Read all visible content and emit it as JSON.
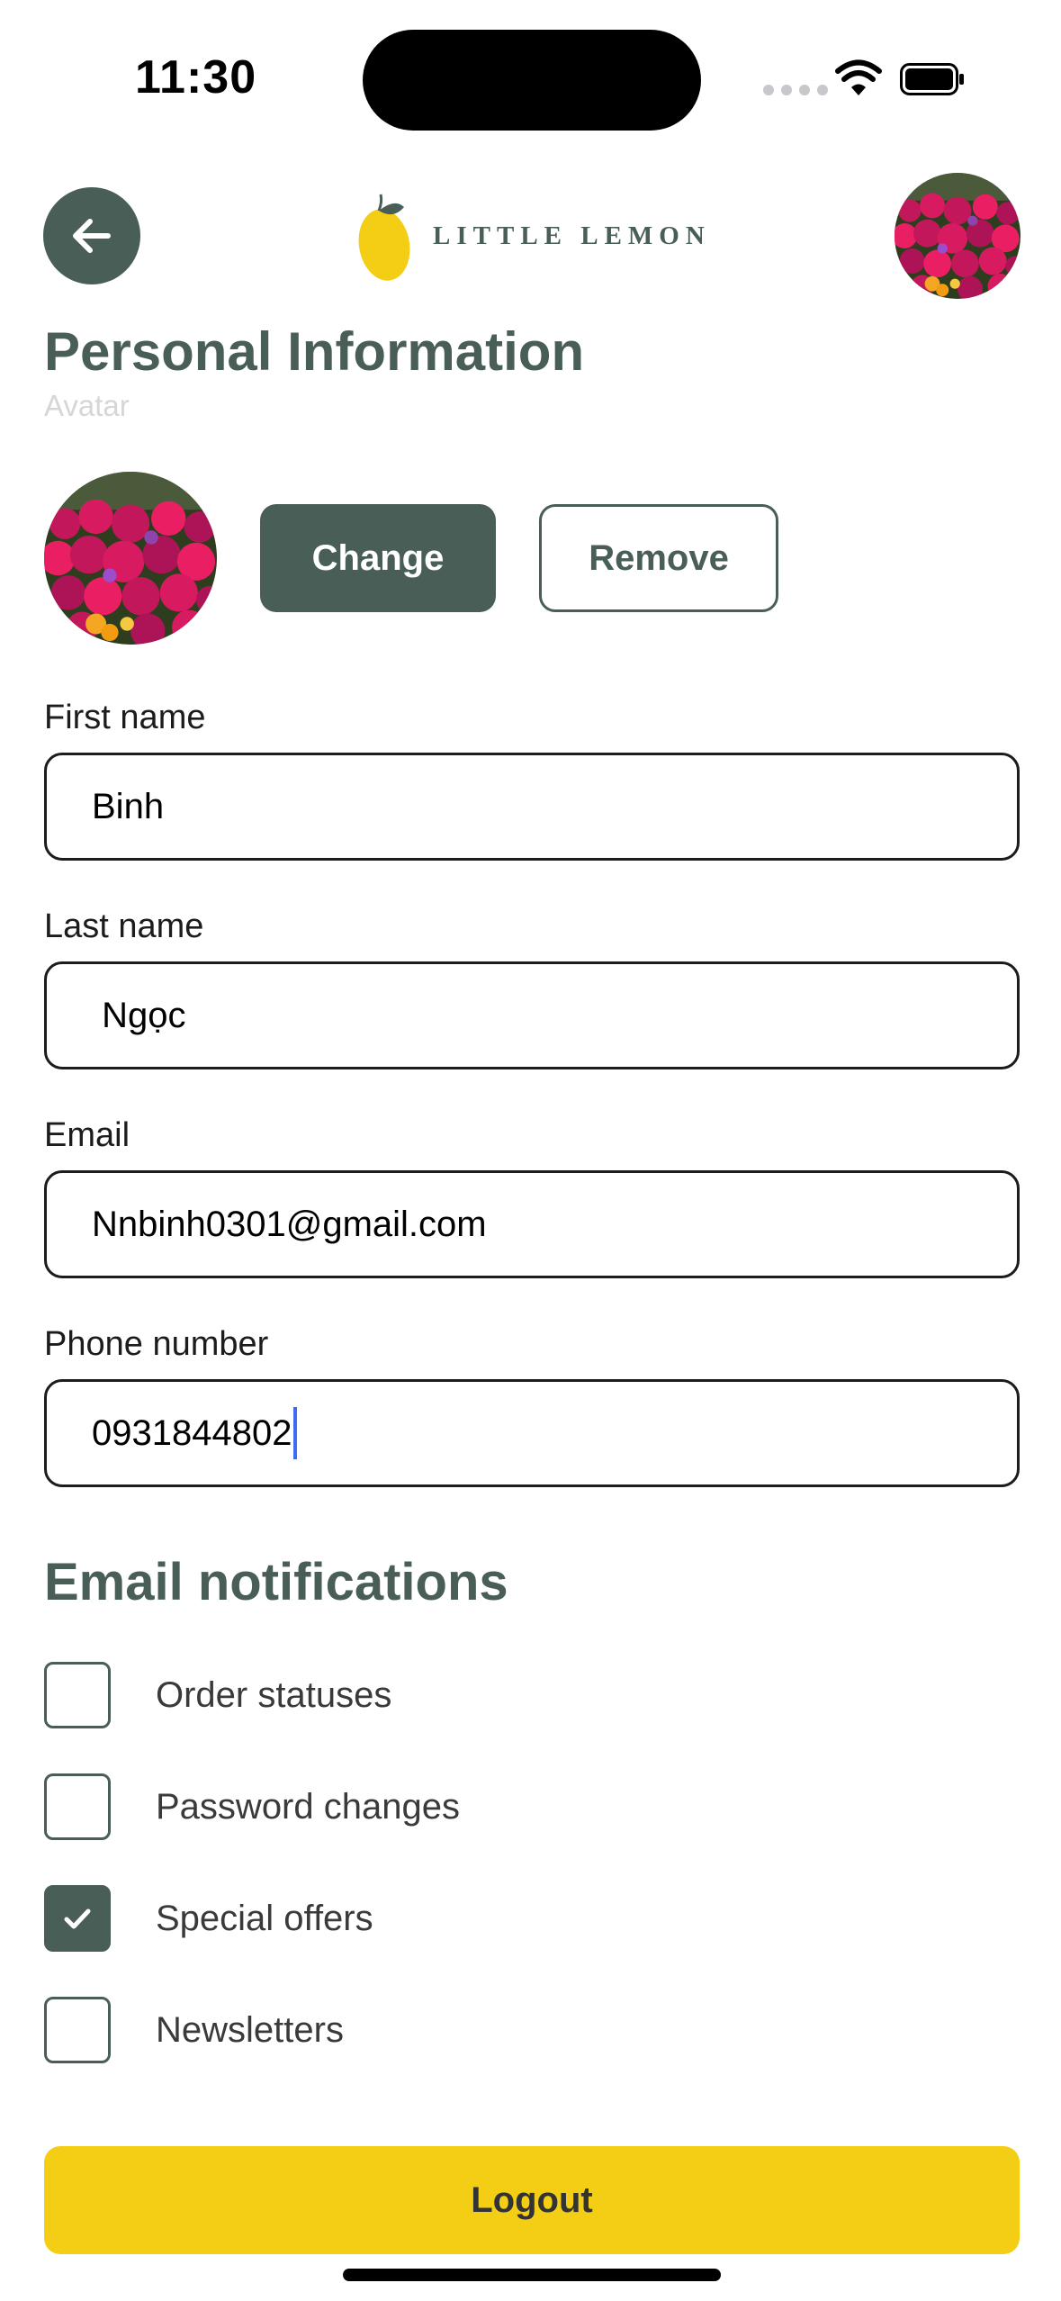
{
  "status_bar": {
    "time": "11:30"
  },
  "header": {
    "logo_text": "LITTLE LEMON"
  },
  "title": "Personal Information",
  "avatar_section": {
    "label": "Avatar",
    "change_label": "Change",
    "remove_label": "Remove"
  },
  "fields": {
    "first_name": {
      "label": "First name",
      "value": "Binh"
    },
    "last_name": {
      "label": "Last name",
      "value": " Ngọc"
    },
    "email": {
      "label": "Email",
      "value": "Nnbinh0301@gmail.com"
    },
    "phone": {
      "label": "Phone number",
      "value": "0931844802"
    }
  },
  "notifications": {
    "title": "Email notifications",
    "items": [
      {
        "label": "Order statuses",
        "checked": false
      },
      {
        "label": "Password changes",
        "checked": false
      },
      {
        "label": "Special offers",
        "checked": true
      },
      {
        "label": "Newsletters",
        "checked": false
      }
    ]
  },
  "logout_label": "Logout",
  "colors": {
    "primary": "#495e57",
    "accent": "#f4ce14",
    "caret": "#3d6cf0"
  }
}
